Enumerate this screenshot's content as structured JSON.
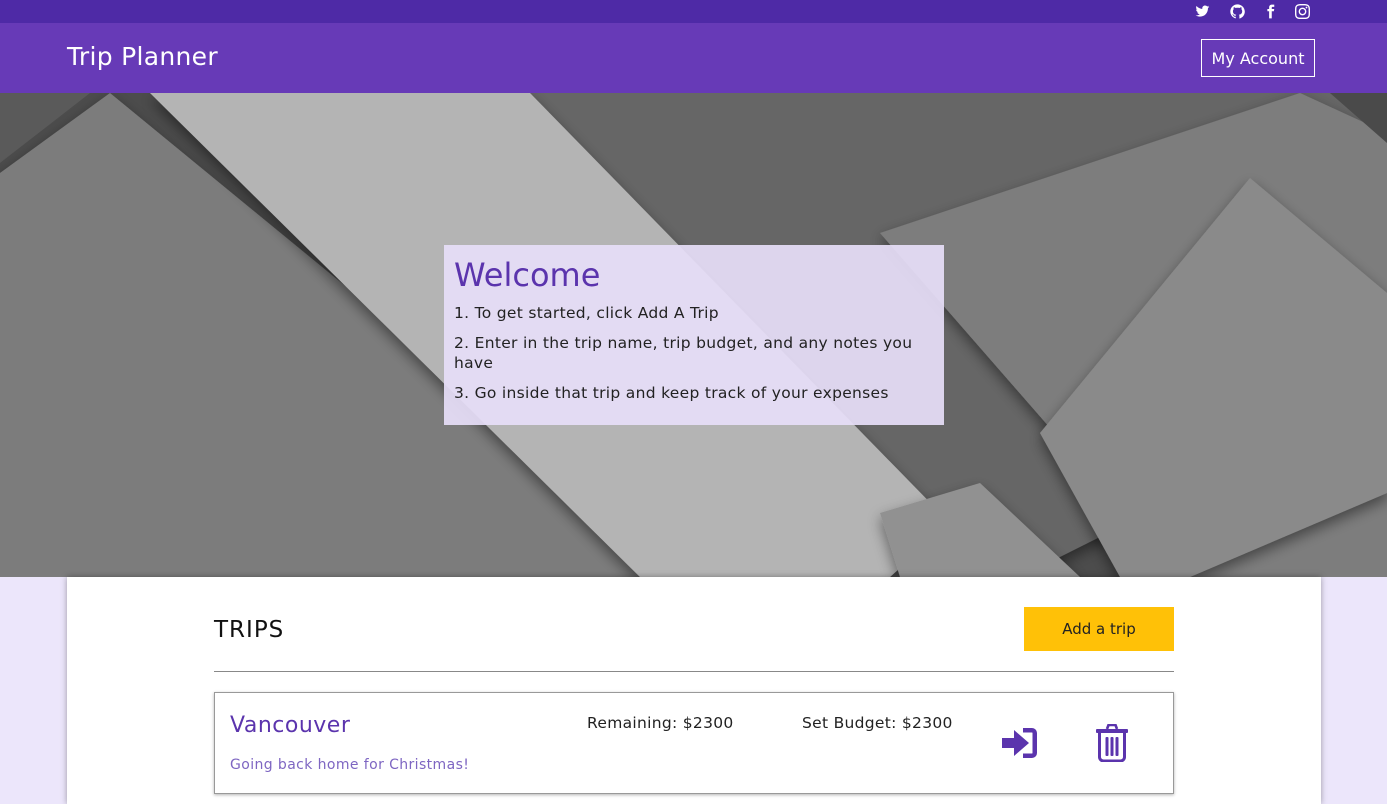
{
  "header": {
    "social_icons": [
      "twitter-icon",
      "github-icon",
      "facebook-icon",
      "instagram-icon"
    ],
    "brand": "Trip Planner",
    "account_label": "My Account"
  },
  "welcome": {
    "title": "Welcome",
    "steps": [
      "1. To get started, click Add A Trip",
      "2. Enter in the trip name, trip budget, and any notes you have",
      "3. Go inside that trip and keep track of your expenses"
    ]
  },
  "trips": {
    "heading": "TRIPS",
    "add_label": "Add a trip",
    "items": [
      {
        "name": "Vancouver",
        "note": "Going back home for Christmas!",
        "remaining": "Remaining: $2300",
        "budget": "Set Budget: $2300",
        "actions": [
          "enter-trip-icon",
          "trash-icon"
        ]
      }
    ]
  },
  "colors": {
    "topbar": "#4e2aa6",
    "navbar": "#673ab7",
    "accent": "#5b34ad",
    "add_button": "#ffc107",
    "page_background": "#ece6fb"
  }
}
